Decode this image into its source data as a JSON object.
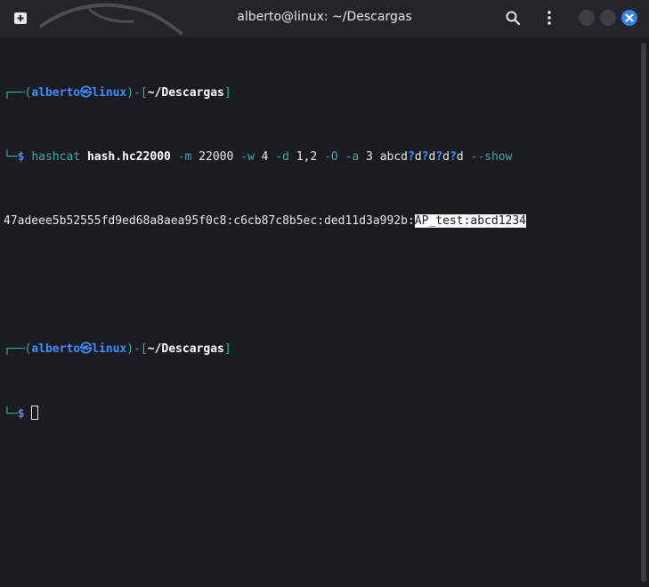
{
  "window": {
    "title": "alberto@linux: ~/Descargas"
  },
  "colors": {
    "accent_close": "#3584e4",
    "prompt_green": "#2bb6a0",
    "prompt_blue": "#3f8cff",
    "background": "#1b1c21"
  },
  "icons": {
    "new_tab": "new-tab-icon",
    "search": "search-icon",
    "menu": "kebab-menu-icon",
    "minimize": "minimize-icon",
    "maximize": "maximize-icon",
    "close": "close-icon"
  },
  "prompt1": {
    "corner_top": "┌──(",
    "user": "alberto",
    "at_symbol": "㉿",
    "host": "linux",
    "mid": ")-[",
    "path": "~/Descargas",
    "end": "]",
    "corner_bottom": "└─",
    "dollar": "$ "
  },
  "command": {
    "program": "hashcat",
    "file": "hash.hc22000",
    "opt_m": "-m",
    "val_m": "22000",
    "opt_w": "-w",
    "val_w": "4",
    "opt_d": "-d",
    "val_d": "1,2",
    "opt_O": "-O",
    "opt_a": "-a",
    "val_a": "3",
    "mask_prefix": "abcd",
    "mask_q": "?",
    "mask_d": "d",
    "opt_show": "--show"
  },
  "output": {
    "hash_part": "47adeee5b52555fd9ed68a8aea95f0c8:c6cb87c8b5ec:ded11d3a992b:",
    "highlighted_part": "AP_test:abcd1234"
  },
  "prompt2": {
    "corner_top": "┌──(",
    "user": "alberto",
    "at_symbol": "㉿",
    "host": "linux",
    "mid": ")-[",
    "path": "~/Descargas",
    "end": "]",
    "corner_bottom": "└─",
    "dollar": "$ "
  }
}
